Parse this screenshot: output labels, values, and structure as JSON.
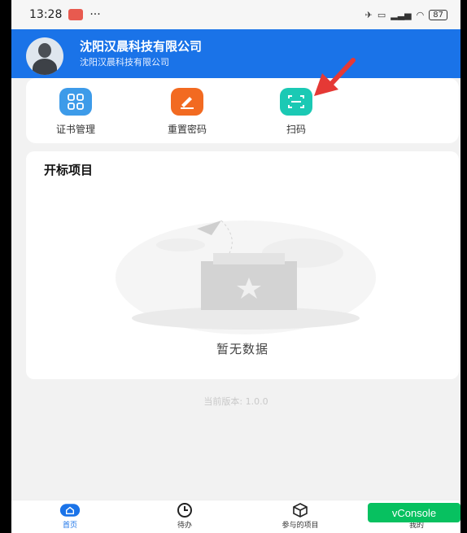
{
  "status_bar": {
    "time": "13:28",
    "dots": "···",
    "battery": "87"
  },
  "header": {
    "company_name": "沈阳汉晨科技有限公司",
    "company_sub": "沈阳汉晨科技有限公司"
  },
  "actions": [
    {
      "label": "证书管理",
      "icon": "grid-icon",
      "color": "#3d9be9"
    },
    {
      "label": "重置密码",
      "icon": "pencil-icon",
      "color": "#f26a21"
    },
    {
      "label": "扫码",
      "icon": "scan-icon",
      "color": "#1bc9b4"
    }
  ],
  "projects": {
    "title": "开标项目",
    "empty_text": "暂无数据"
  },
  "version_text": "当前版本: 1.0.0",
  "tabbar": [
    {
      "label": "首页",
      "icon": "home-icon",
      "active": true
    },
    {
      "label": "待办",
      "icon": "clock-icon"
    },
    {
      "label": "参与的项目",
      "icon": "cube-icon"
    },
    {
      "label": "我的",
      "icon": "user-icon"
    }
  ],
  "vconsole_label": "vConsole",
  "colors": {
    "primary": "#1a73e8",
    "accent_red": "#e53935",
    "vconsole": "#07c160"
  }
}
